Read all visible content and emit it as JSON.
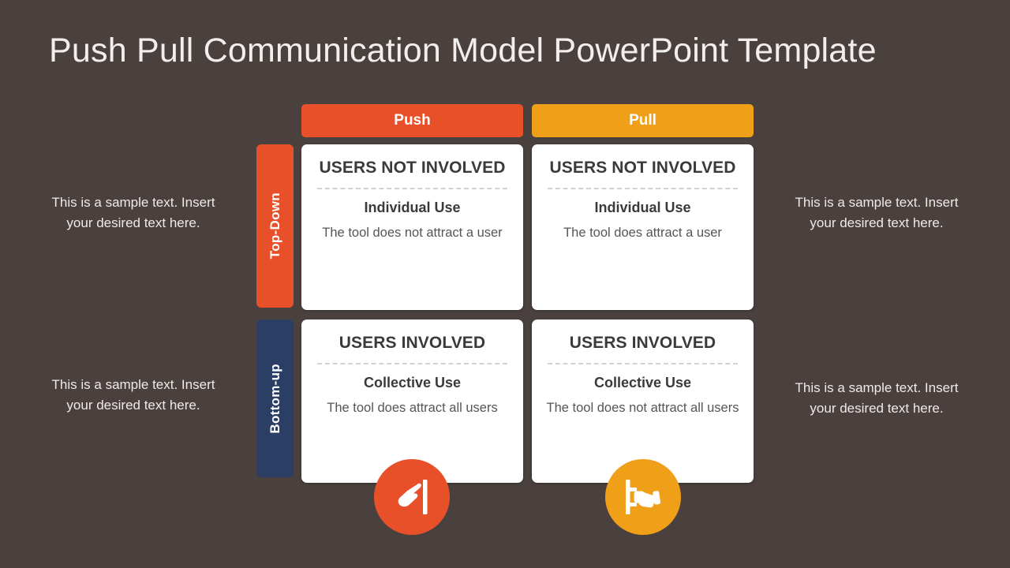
{
  "slide": {
    "title": "Push Pull Communication Model PowerPoint Template",
    "background_color": "#4a413f"
  },
  "colors": {
    "push": "#e8502a",
    "pull": "#f0a018",
    "bottom_up_tab": "#2b3e64",
    "card_background": "#ffffff",
    "title_text": "#f2eeec"
  },
  "columns": [
    {
      "label": "Push",
      "color": "#e8502a"
    },
    {
      "label": "Pull",
      "color": "#f0a018"
    }
  ],
  "rows": [
    {
      "label": "Top-Down",
      "color": "#e8502a"
    },
    {
      "label": "Bottom-up",
      "color": "#2b3e64"
    }
  ],
  "cards": [
    {
      "heading": "USERS NOT INVOLVED",
      "subtitle": "Individual Use",
      "body": "The tool does not attract a user"
    },
    {
      "heading": "USERS NOT INVOLVED",
      "subtitle": "Individual Use",
      "body": "The tool does attract a user"
    },
    {
      "heading": "USERS INVOLVED",
      "subtitle": "Collective Use",
      "body": "The tool does attract all users"
    },
    {
      "heading": "USERS INVOLVED",
      "subtitle": "Collective Use",
      "body": "The tool does not attract all users"
    }
  ],
  "side_notes": {
    "left_top": "This is a sample text. Insert your desired text here.",
    "left_bottom": "This is a sample text. Insert your desired text here.",
    "right_top": "This is a sample text. Insert your desired text here.",
    "right_bottom": "This is a sample text. Insert your desired text here."
  },
  "icons": [
    {
      "name": "hand-push-icon",
      "color": "#e8502a"
    },
    {
      "name": "hand-pull-icon",
      "color": "#f0a018"
    }
  ]
}
